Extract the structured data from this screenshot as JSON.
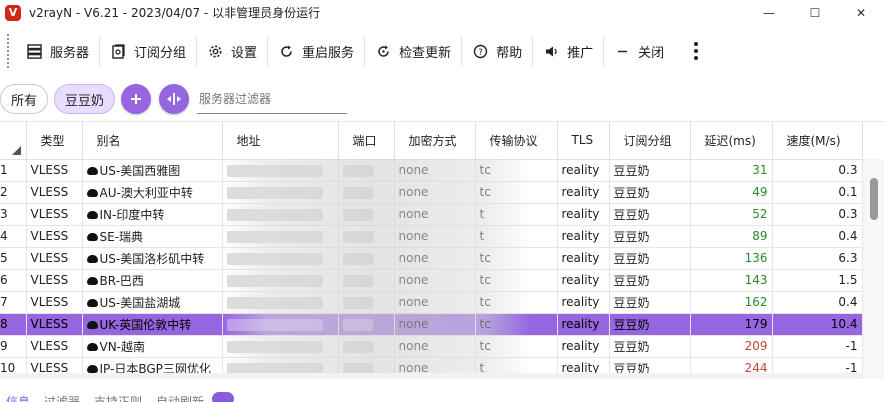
{
  "window": {
    "title": "v2rayN - V6.21 - 2023/04/07 - 以非管理员身份运行",
    "app_icon_letter": "V",
    "minimize_glyph": "—",
    "maximize_glyph": "☐",
    "close_glyph": "✕"
  },
  "toolbar": {
    "items": [
      {
        "label": "服务器",
        "icon": "server-icon"
      },
      {
        "label": "订阅分组",
        "icon": "subscription-icon"
      },
      {
        "label": "设置",
        "icon": "gear-icon"
      },
      {
        "label": "重启服务",
        "icon": "restart-icon"
      },
      {
        "label": "检查更新",
        "icon": "update-icon"
      },
      {
        "label": "帮助",
        "icon": "help-icon"
      },
      {
        "label": "推广",
        "icon": "speaker-icon"
      },
      {
        "label": "关闭",
        "icon": "minus-icon"
      }
    ]
  },
  "filterbar": {
    "all_label": "所有",
    "active_group": "豆豆奶",
    "filter_placeholder": "服务器过滤器"
  },
  "table": {
    "columns": [
      "",
      "类型",
      "别名",
      "地址",
      "端口",
      "加密方式",
      "传输协议",
      "TLS",
      "订阅分组",
      "延迟(ms)",
      "速度(M/s)"
    ],
    "rows": [
      {
        "idx": "1",
        "type": "VLESS",
        "alias": "US-美国西雅图",
        "addr": "",
        "port": "",
        "enc": "none",
        "net": "tc",
        "tls": "reality",
        "group": "豆豆奶",
        "latency": "31",
        "speed": "0.3",
        "lat_color": "green"
      },
      {
        "idx": "2",
        "type": "VLESS",
        "alias": "AU-澳大利亚中转",
        "addr": "",
        "port": "",
        "enc": "none",
        "net": "tc",
        "tls": "reality",
        "group": "豆豆奶",
        "latency": "49",
        "speed": "0.1",
        "lat_color": "green"
      },
      {
        "idx": "3",
        "type": "VLESS",
        "alias": "IN-印度中转",
        "addr": "",
        "port": "",
        "enc": "none",
        "net": "t",
        "tls": "reality",
        "group": "豆豆奶",
        "latency": "52",
        "speed": "0.3",
        "lat_color": "green"
      },
      {
        "idx": "4",
        "type": "VLESS",
        "alias": "SE-瑞典",
        "addr": "",
        "port": "",
        "enc": "none",
        "net": "t",
        "tls": "reality",
        "group": "豆豆奶",
        "latency": "89",
        "speed": "0.4",
        "lat_color": "green"
      },
      {
        "idx": "5",
        "type": "VLESS",
        "alias": "US-美国洛杉矶中转",
        "addr": "",
        "port": "",
        "enc": "none",
        "net": "tc",
        "tls": "reality",
        "group": "豆豆奶",
        "latency": "136",
        "speed": "6.3",
        "lat_color": "green"
      },
      {
        "idx": "6",
        "type": "VLESS",
        "alias": "BR-巴西",
        "addr": "",
        "port": "",
        "enc": "none",
        "net": "tc",
        "tls": "reality",
        "group": "豆豆奶",
        "latency": "143",
        "speed": "1.5",
        "lat_color": "green"
      },
      {
        "idx": "7",
        "type": "VLESS",
        "alias": "US-美国盐湖城",
        "addr": "",
        "port": "",
        "enc": "none",
        "net": "tc",
        "tls": "reality",
        "group": "豆豆奶",
        "latency": "162",
        "speed": "0.4",
        "lat_color": "green"
      },
      {
        "idx": "8",
        "type": "VLESS",
        "alias": "UK-英国伦敦中转",
        "addr": "",
        "port": "",
        "enc": "none",
        "net": "tc",
        "tls": "reality",
        "group": "豆豆奶",
        "latency": "179",
        "speed": "10.4",
        "lat_color": "green",
        "selected": true
      },
      {
        "idx": "9",
        "type": "VLESS",
        "alias": "VN-越南",
        "addr": "",
        "port": "",
        "enc": "none",
        "net": "tc",
        "tls": "reality",
        "group": "豆豆奶",
        "latency": "209",
        "speed": "-1",
        "lat_color": "red"
      },
      {
        "idx": "10",
        "type": "VLESS",
        "alias": "JP-日本BGP三网优化",
        "addr": "",
        "port": "",
        "enc": "none",
        "net": "t",
        "tls": "reality",
        "group": "豆豆奶",
        "latency": "244",
        "speed": "-1",
        "lat_color": "red"
      }
    ]
  },
  "colors": {
    "accent": "#9566e0",
    "latency_green": "#2d8a2d",
    "latency_red": "#c0483e"
  },
  "statusbar": {
    "info": "信息",
    "filter": "过滤器",
    "regex": "支持正则",
    "auto_refresh": "自动刷新"
  }
}
